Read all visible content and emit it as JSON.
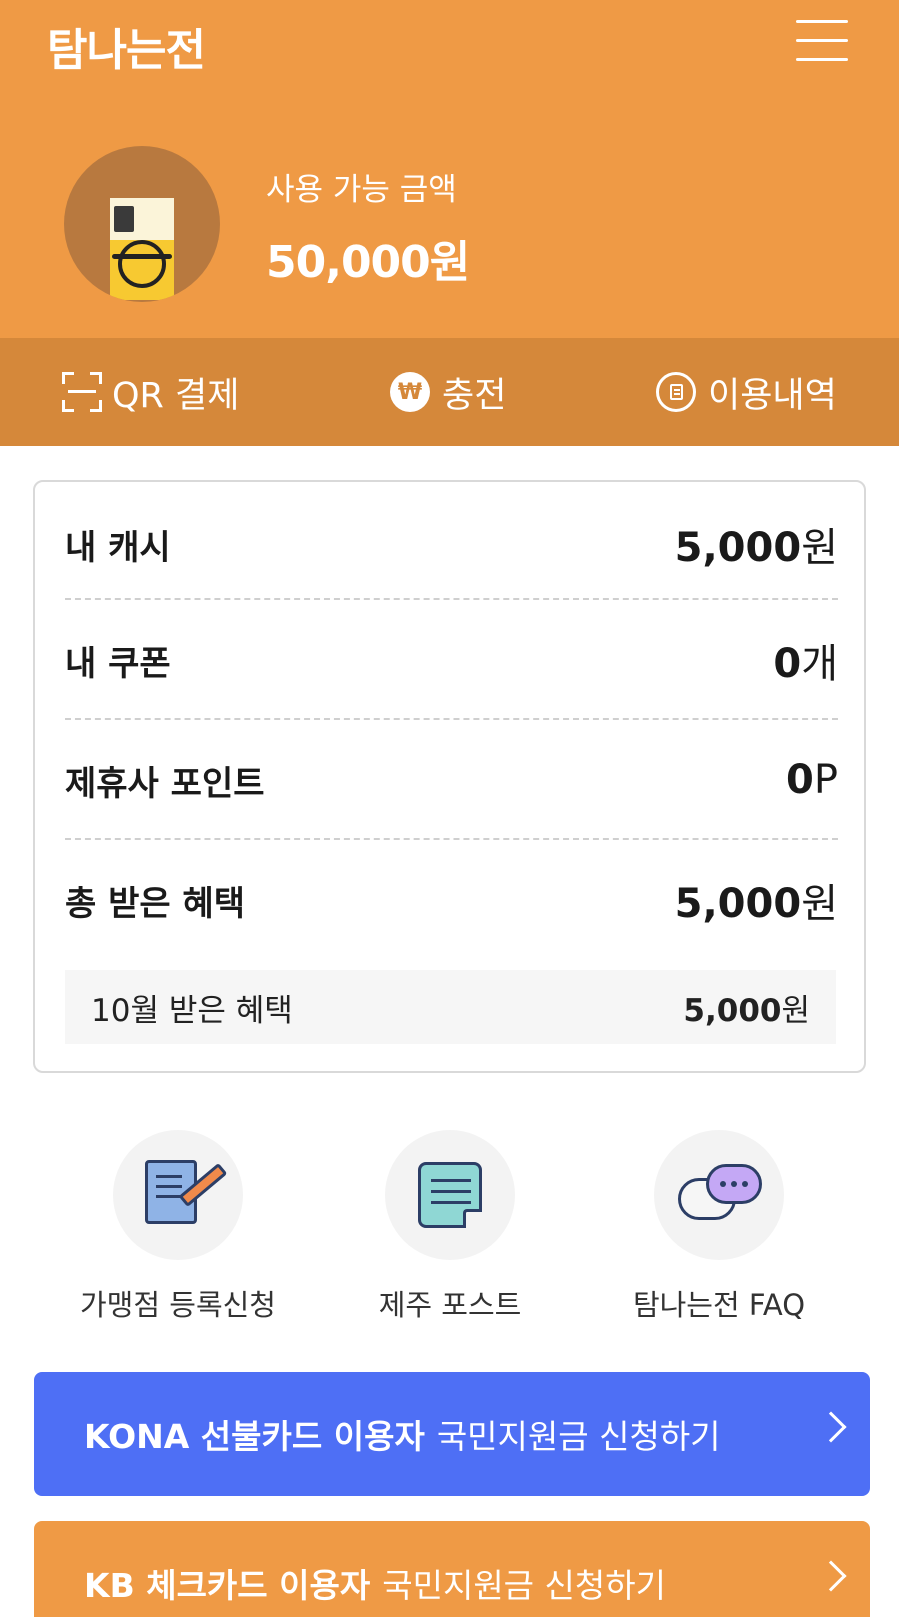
{
  "header": {
    "app_title": "탐나는전",
    "balance_label": "사용 가능 금액",
    "balance_value": "50,000원"
  },
  "actions": {
    "qr_pay": "QR 결제",
    "charge": "충전",
    "charge_symbol": "₩",
    "history": "이용내역"
  },
  "summary": {
    "cash": {
      "label": "내 캐시",
      "value": "5,000",
      "unit": "원"
    },
    "coupon": {
      "label": "내 쿠폰",
      "value": "0",
      "unit": "개"
    },
    "partner_points": {
      "label": "제휴사 포인트",
      "value": "0",
      "unit": "P"
    },
    "total_benefit": {
      "label": "총 받은 혜택",
      "value": "5,000",
      "unit": "원"
    },
    "month_benefit": {
      "label": "10월 받은 혜택",
      "value": "5,000",
      "unit": "원"
    }
  },
  "shortcuts": [
    {
      "label": "가맹점 등록신청",
      "icon": "register-document-pencil-icon"
    },
    {
      "label": "제주 포스트",
      "icon": "post-note-icon"
    },
    {
      "label": "탐나는전 FAQ",
      "icon": "chat-bubbles-icon"
    }
  ],
  "banners": [
    {
      "bold": "KONA 선불카드 이용자",
      "text": "국민지원금 신청하기",
      "color": "#4e6ff5"
    },
    {
      "bold": "KB 체크카드 이용자",
      "text": "국민지원금 신청하기",
      "color": "#ef9a45"
    }
  ],
  "colors": {
    "header": "#ef9a45",
    "action_bar": "#d5883a",
    "kona_banner": "#4e6ff5",
    "kb_banner": "#ef9a45"
  }
}
